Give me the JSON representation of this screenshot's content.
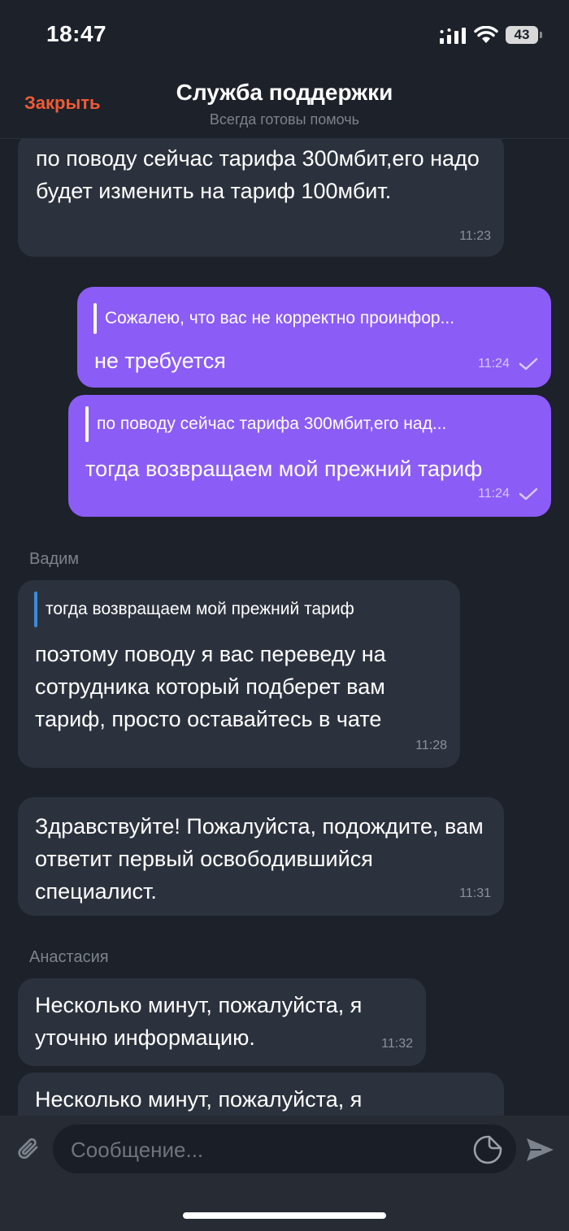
{
  "status_bar": {
    "time": "18:47",
    "battery": "43"
  },
  "header": {
    "close_label": "Закрыть",
    "title": "Служба поддержки",
    "subtitle": "Всегда готовы помочь"
  },
  "messages": [
    {
      "dir": "in",
      "text": "по поводу сейчас тарифа 300мбит,его надо будет изменить на тариф 100мбит.",
      "time": "11:23"
    },
    {
      "dir": "out",
      "quote": "Сожалею, что вас не корректно проинфор...",
      "text": "не требуется",
      "time": "11:24"
    },
    {
      "dir": "out",
      "quote": "по поводу сейчас тарифа 300мбит,его над...",
      "text": "тогда возвращаем мой прежний тариф",
      "time": "11:24"
    },
    {
      "dir": "in",
      "sender": "Вадим",
      "quote": "тогда возвращаем мой прежний тариф",
      "text": "поэтому поводу я вас переведу на сотрудника который подберет вам тариф, просто оставайтесь в чате",
      "time": "11:28"
    },
    {
      "dir": "in",
      "text": "Здравствуйте! Пожалуйста, подождите, вам ответит первый освободившийся специалист.",
      "time": "11:31"
    },
    {
      "dir": "in",
      "sender": "Анастасия",
      "text": "Несколько минут, пожалуйста, я уточню информацию.",
      "time": "11:32"
    },
    {
      "dir": "in",
      "text": "Несколько минут, пожалуйста, я"
    }
  ],
  "composer": {
    "placeholder": "Сообщение..."
  },
  "colors": {
    "accent": "#ef5b35",
    "outgoing": "#8c5cf6",
    "incoming": "#2c323d",
    "quote_bar_in": "#3d8bd9"
  }
}
